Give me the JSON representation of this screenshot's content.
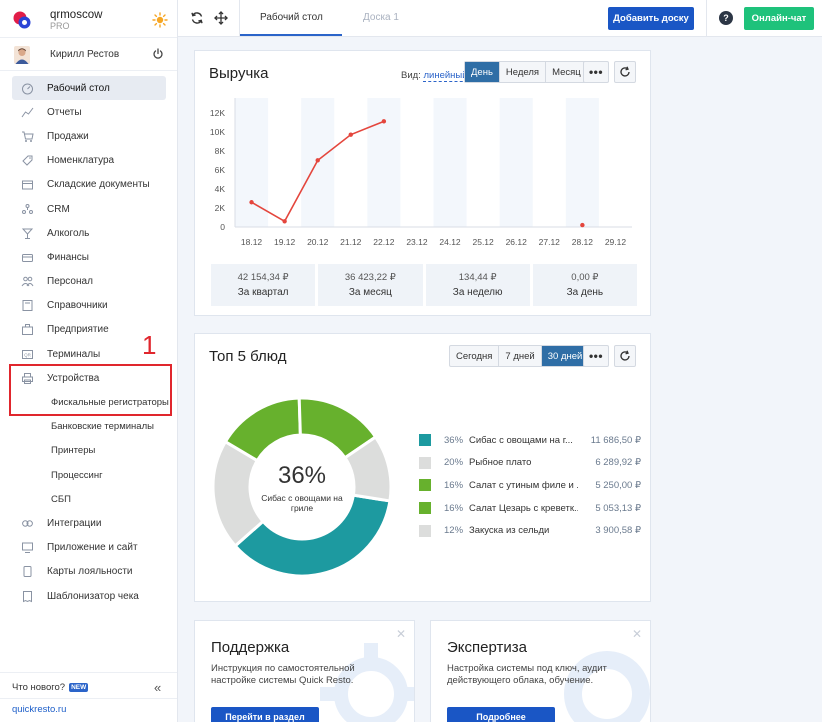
{
  "brand": {
    "name": "qrmoscow",
    "plan": "PRO"
  },
  "user": {
    "name": "Кирилл Рестов"
  },
  "nav": [
    {
      "label": "Рабочий стол",
      "icon": "dashboard-icon",
      "active": true
    },
    {
      "label": "Отчеты",
      "icon": "reports-icon"
    },
    {
      "label": "Продажи",
      "icon": "sales-icon"
    },
    {
      "label": "Номенклатура",
      "icon": "nomenclature-icon"
    },
    {
      "label": "Складские документы",
      "icon": "warehouse-icon"
    },
    {
      "label": "CRM",
      "icon": "crm-icon"
    },
    {
      "label": "Алкоголь",
      "icon": "alcohol-icon"
    },
    {
      "label": "Финансы",
      "icon": "finance-icon"
    },
    {
      "label": "Персонал",
      "icon": "staff-icon"
    },
    {
      "label": "Справочники",
      "icon": "directory-icon"
    },
    {
      "label": "Предприятие",
      "icon": "enterprise-icon"
    },
    {
      "label": "Терминалы",
      "icon": "terminal-icon"
    },
    {
      "label": "Устройства",
      "icon": "printer-icon"
    },
    {
      "label": "Фискальные регистраторы",
      "sub": true
    },
    {
      "label": "Банковские терминалы",
      "sub": true
    },
    {
      "label": "Принтеры",
      "sub": true
    },
    {
      "label": "Процессинг",
      "sub": true
    },
    {
      "label": "СБП",
      "sub": true
    },
    {
      "label": "Интеграции",
      "icon": "integrations-icon"
    },
    {
      "label": "Приложение и сайт",
      "icon": "app-icon"
    },
    {
      "label": "Карты лояльности",
      "icon": "loyalty-icon"
    },
    {
      "label": "Шаблонизатор чека",
      "icon": "receipt-icon"
    }
  ],
  "annotation": {
    "number": "1"
  },
  "footer": {
    "whats_new": "Что нового?",
    "badge": "NEW",
    "site": "quickresto.ru"
  },
  "topbar": {
    "tabs": [
      {
        "label": "Рабочий стол"
      },
      {
        "label": "Доска 1"
      }
    ],
    "add_board": "Добавить доску",
    "help": "?",
    "chat": "Онлайн-чат"
  },
  "revenue": {
    "title": "Выручка",
    "view_label": "Вид:",
    "view_value": "линейный",
    "periods": [
      "День",
      "Неделя",
      "Месяц"
    ],
    "active_period": 0,
    "stats": [
      {
        "value": "42 154,34 ₽",
        "label": "За квартал"
      },
      {
        "value": "36 423,22 ₽",
        "label": "За месяц"
      },
      {
        "value": "134,44 ₽",
        "label": "За неделю"
      },
      {
        "value": "0,00 ₽",
        "label": "За день"
      }
    ]
  },
  "chart_data": {
    "type": "line",
    "categories": [
      "18.12",
      "19.12",
      "20.12",
      "21.12",
      "22.12",
      "23.12",
      "24.12",
      "25.12",
      "26.12",
      "27.12",
      "28.12",
      "29.12"
    ],
    "values": [
      2600,
      600,
      7000,
      9700,
      11100,
      null,
      null,
      null,
      null,
      null,
      200,
      null
    ],
    "y_ticks": [
      "0",
      "2K",
      "4K",
      "6K",
      "8K",
      "10K",
      "12K"
    ],
    "ylim": [
      0,
      12500
    ],
    "color": "#e4463d"
  },
  "top_dishes": {
    "title": "Топ 5 блюд",
    "periods": [
      "Сегодня",
      "7 дней",
      "30 дней"
    ],
    "active_period": 2,
    "center_pct": "36%",
    "center_label": "Сибас с овощами на гриле",
    "items": [
      {
        "pct": "36%",
        "name": "Сибас с овощами на г...",
        "value": "11 686,50 ₽",
        "color": "#1d9aa0",
        "share": 36
      },
      {
        "pct": "20%",
        "name": "Рыбное плато",
        "value": "6 289,92 ₽",
        "color": "#dcdddc",
        "share": 20
      },
      {
        "pct": "16%",
        "name": "Салат с утиным филе и ...",
        "value": "5 250,00 ₽",
        "color": "#67b12d",
        "share": 16
      },
      {
        "pct": "16%",
        "name": "Салат Цезарь с креветк...",
        "value": "5 053,13 ₽",
        "color": "#67b12d",
        "share": 16
      },
      {
        "pct": "12%",
        "name": "Закуска из сельди",
        "value": "3 900,58 ₽",
        "color": "#dcdddc",
        "share": 12
      }
    ]
  },
  "support": {
    "title": "Поддержка",
    "text": "Инструкция по самостоятельной настройке системы Quick Resto.",
    "button": "Перейти в раздел"
  },
  "expertise": {
    "title": "Экспертиза",
    "text": "Настройка системы под ключ, аудит действующего облака, обучение.",
    "button": "Подробнее"
  }
}
